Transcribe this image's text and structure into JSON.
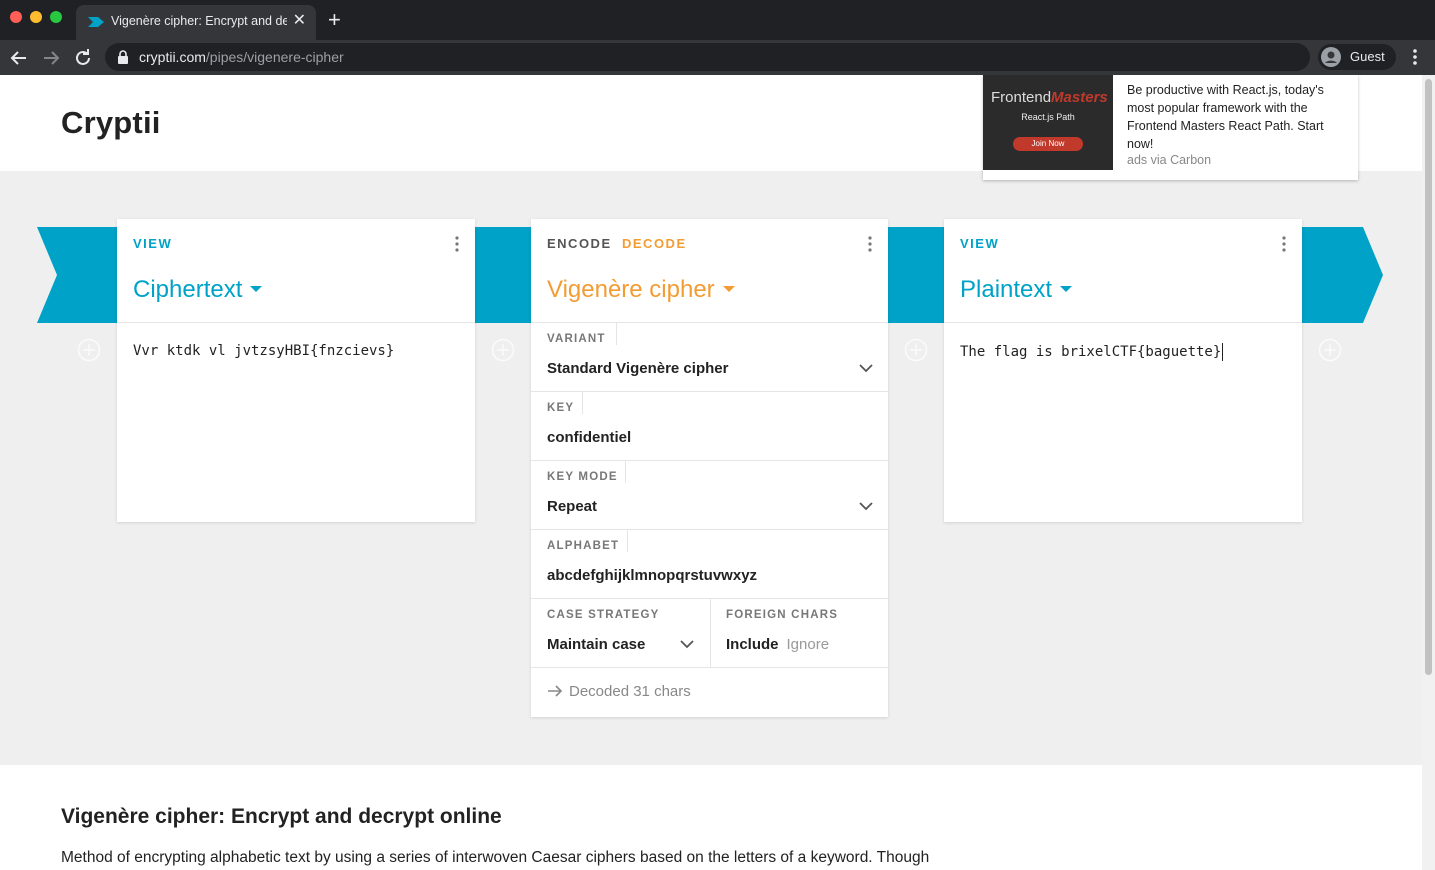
{
  "browser": {
    "tab_title": "Vigenère cipher: Encrypt and decrypt online",
    "tab_close": "✕",
    "new_tab": "+",
    "url_host": "cryptii.com",
    "url_path": "/pipes/vigenere-cipher",
    "profile_label": "Guest"
  },
  "header": {
    "logo": "Cryptii"
  },
  "ad": {
    "brand_part1": "Frontend",
    "brand_part2": "Masters",
    "path_label": "React.js Path",
    "join_label": "Join Now",
    "text": "Be productive with React.js, today's most popular framework with the Frontend Masters React Path. Start now!",
    "via": "ads via Carbon"
  },
  "colors": {
    "accent": "#00a2c8",
    "orange": "#f39c34"
  },
  "cards": {
    "left": {
      "label": "VIEW",
      "title": "Ciphertext",
      "content": "Vvr ktdk vl jvtzsyHBI{fnzcievs}"
    },
    "middle": {
      "label_encode": "ENCODE",
      "label_decode": "DECODE",
      "title": "Vigenère cipher",
      "fields": {
        "variant_label": "VARIANT",
        "variant_value": "Standard Vigenère cipher",
        "key_label": "KEY",
        "key_value": "confidentiel",
        "key_mode_label": "KEY MODE",
        "key_mode_value": "Repeat",
        "alphabet_label": "ALPHABET",
        "alphabet_value": "abcdefghijklmnopqrstuvwxyz",
        "case_label": "CASE STRATEGY",
        "case_value": "Maintain case",
        "foreign_label": "FOREIGN CHARS",
        "foreign_include": "Include",
        "foreign_ignore": "Ignore"
      },
      "status": "Decoded 31 chars"
    },
    "right": {
      "label": "VIEW",
      "title": "Plaintext",
      "content": "The flag is brixelCTF{baguette}"
    }
  },
  "article": {
    "title": "Vigenère cipher: Encrypt and decrypt online",
    "text": "Method of encrypting alphabetic text by using a series of interwoven Caesar ciphers based on the letters of a keyword. Though"
  }
}
